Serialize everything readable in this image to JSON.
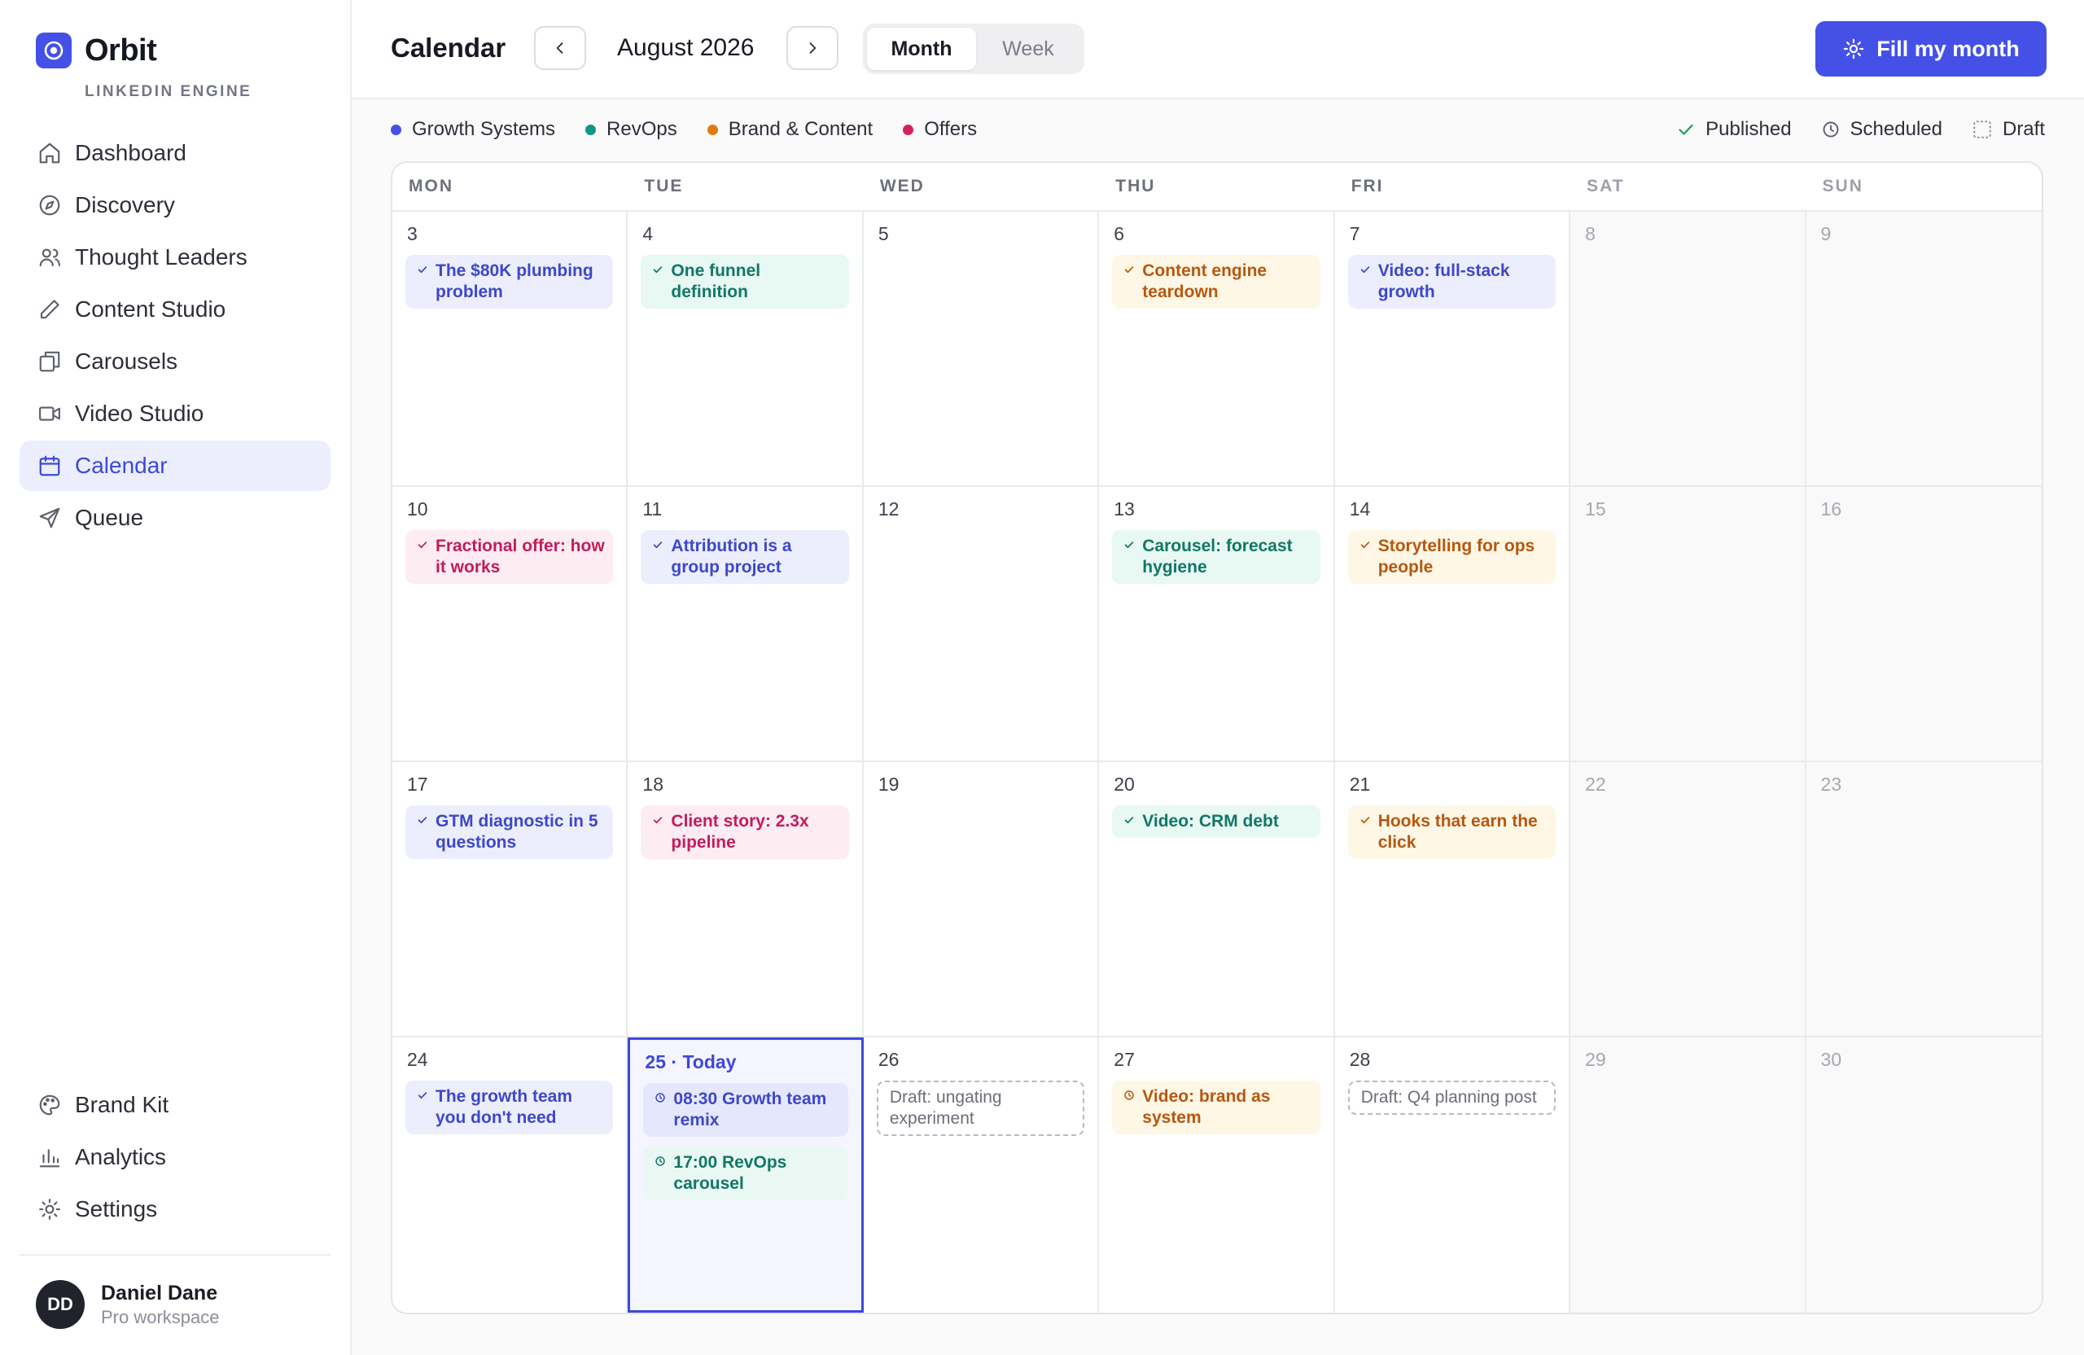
{
  "app": {
    "name": "Orbit",
    "subtitle": "LINKEDIN ENGINE"
  },
  "sidebar": {
    "items": [
      {
        "label": "Dashboard",
        "icon": "home-icon"
      },
      {
        "label": "Discovery",
        "icon": "compass-icon"
      },
      {
        "label": "Thought Leaders",
        "icon": "users-icon"
      },
      {
        "label": "Content Studio",
        "icon": "pencil-icon"
      },
      {
        "label": "Carousels",
        "icon": "copy-icon"
      },
      {
        "label": "Video Studio",
        "icon": "video-icon"
      },
      {
        "label": "Calendar",
        "icon": "calendar-icon",
        "active": true
      },
      {
        "label": "Queue",
        "icon": "send-icon"
      }
    ],
    "bottom_items": [
      {
        "label": "Brand Kit",
        "icon": "palette-icon"
      },
      {
        "label": "Analytics",
        "icon": "bar-chart-icon"
      },
      {
        "label": "Settings",
        "icon": "sun-icon"
      }
    ]
  },
  "user": {
    "initials": "DD",
    "name": "Daniel Dane",
    "plan": "Pro workspace"
  },
  "header": {
    "title": "Calendar",
    "month": "August 2026",
    "view_month": "Month",
    "view_week": "Week",
    "active_view": "Month",
    "fill_button": "Fill my month"
  },
  "legend": {
    "categories": [
      {
        "label": "Growth Systems",
        "color": "#4551e6"
      },
      {
        "label": "RevOps",
        "color": "#13968a"
      },
      {
        "label": "Brand & Content",
        "color": "#e17a0e"
      },
      {
        "label": "Offers",
        "color": "#d61f63"
      }
    ],
    "statuses": {
      "published": "Published",
      "scheduled": "Scheduled",
      "draft": "Draft"
    }
  },
  "calendar": {
    "weekdays": [
      "MON",
      "TUE",
      "WED",
      "THU",
      "FRI",
      "SAT",
      "SUN"
    ],
    "weeks": [
      [
        {
          "day": "3",
          "posts": [
            {
              "title": "The $80K plumbing problem",
              "color": "blue",
              "status": "published"
            }
          ]
        },
        {
          "day": "4",
          "posts": [
            {
              "title": "One funnel definition",
              "color": "green",
              "status": "published"
            }
          ]
        },
        {
          "day": "5",
          "posts": []
        },
        {
          "day": "6",
          "posts": [
            {
              "title": "Content engine teardown",
              "color": "amber",
              "status": "published"
            }
          ]
        },
        {
          "day": "7",
          "posts": [
            {
              "title": "Video: full-stack growth",
              "color": "blue",
              "status": "published"
            }
          ]
        },
        {
          "day": "8",
          "posts": [],
          "weekend": true
        },
        {
          "day": "9",
          "posts": [],
          "weekend": true
        }
      ],
      [
        {
          "day": "10",
          "posts": [
            {
              "title": "Fractional offer: how it works",
              "color": "pink",
              "status": "published"
            }
          ]
        },
        {
          "day": "11",
          "posts": [
            {
              "title": "Attribution is a group project",
              "color": "blue",
              "status": "published"
            }
          ]
        },
        {
          "day": "12",
          "posts": []
        },
        {
          "day": "13",
          "posts": [
            {
              "title": "Carousel: forecast hygiene",
              "color": "green",
              "status": "published"
            }
          ]
        },
        {
          "day": "14",
          "posts": [
            {
              "title": "Storytelling for ops people",
              "color": "amber",
              "status": "published"
            }
          ]
        },
        {
          "day": "15",
          "posts": [],
          "weekend": true
        },
        {
          "day": "16",
          "posts": [],
          "weekend": true
        }
      ],
      [
        {
          "day": "17",
          "posts": [
            {
              "title": "GTM diagnostic in 5 questions",
              "color": "blue",
              "status": "published"
            }
          ]
        },
        {
          "day": "18",
          "posts": [
            {
              "title": "Client story: 2.3x pipeline",
              "color": "pink",
              "status": "published"
            }
          ]
        },
        {
          "day": "19",
          "posts": []
        },
        {
          "day": "20",
          "posts": [
            {
              "title": "Video: CRM debt",
              "color": "green",
              "status": "published"
            }
          ]
        },
        {
          "day": "21",
          "posts": [
            {
              "title": "Hooks that earn the click",
              "color": "amber",
              "status": "published"
            }
          ]
        },
        {
          "day": "22",
          "posts": [],
          "weekend": true
        },
        {
          "day": "23",
          "posts": [],
          "weekend": true
        }
      ],
      [
        {
          "day": "24",
          "posts": [
            {
              "title": "The growth team you don't need",
              "color": "blue",
              "status": "published"
            }
          ]
        },
        {
          "day": "25 · Today",
          "today": true,
          "posts": [
            {
              "title": "08:30 Growth team remix",
              "color": "blue",
              "status": "scheduled"
            },
            {
              "title": "17:00 RevOps carousel",
              "color": "green",
              "status": "scheduled"
            }
          ]
        },
        {
          "day": "26",
          "posts": [
            {
              "title": "Draft: ungating experiment",
              "color": "draft",
              "status": "draft"
            }
          ]
        },
        {
          "day": "27",
          "posts": [
            {
              "title": "Video: brand as system",
              "color": "amber",
              "status": "scheduled"
            }
          ]
        },
        {
          "day": "28",
          "posts": [
            {
              "title": "Draft: Q4 planning post",
              "color": "draft",
              "status": "draft"
            }
          ]
        },
        {
          "day": "29",
          "posts": [],
          "weekend": true
        },
        {
          "day": "30",
          "posts": [],
          "weekend": true
        }
      ]
    ]
  }
}
